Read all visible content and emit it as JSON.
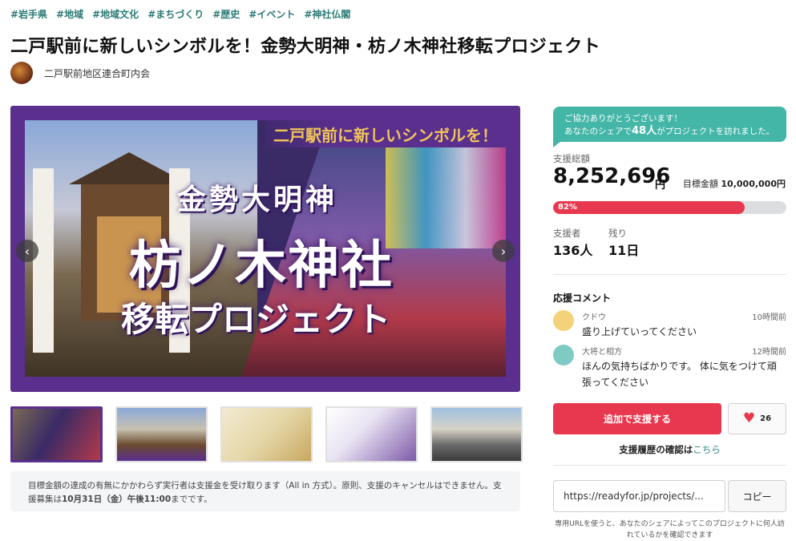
{
  "tags": [
    "#岩手県",
    "#地域",
    "#地域文化",
    "#まちづくり",
    "#歴史",
    "#イベント",
    "#神社仏閣"
  ],
  "title": "二戸駅前に新しいシンボルを！金勢大明神・枋ノ木神社移転プロジェクト",
  "owner": {
    "name": "二戸駅前地区連合町内会",
    "avatar_icon": "owner-avatar-icon"
  },
  "hero": {
    "banner_text": "二戸駅前に新しいシンボルを！",
    "line1": "金勢大明神",
    "line2": "枋ノ木神社",
    "line3": "移転プロジェクト",
    "prev_icon": "chevron-left-icon",
    "next_icon": "chevron-right-icon",
    "accent": "#5a2f8e"
  },
  "thumbnails_count": 5,
  "notice": {
    "text": "目標金額の達成の有無にかかわらず実行者は支援金を受け取ります（All in 方式）。原則、支援のキャンセルはできません。支援募集は",
    "deadline": "10月31日（金）午後11:00",
    "suffix": "までです。"
  },
  "share_bubble": {
    "line1": "ご協力ありがとうございます！",
    "line2_prefix": "あなたのシェアで",
    "count": "48人",
    "line2_suffix": "がプロジェクトを訪れました。",
    "color": "#43b6a7"
  },
  "funding": {
    "total_label": "支援総額",
    "total": "8,252,696",
    "unit": "円",
    "goal_label": "目標金額",
    "goal": "10,000,000円",
    "percent": 82,
    "percent_label": "82%",
    "supporters_label": "支援者",
    "supporters": "136人",
    "remaining_label": "残り",
    "remaining": "11日",
    "accent": "#e8384f"
  },
  "comments": {
    "heading": "応援コメント",
    "items": [
      {
        "name": "クドウ",
        "time": "10時間前",
        "text": "盛り上げていってください",
        "avatar_color": "#f3d27a"
      },
      {
        "name": "大将と相方",
        "time": "12時間前",
        "text": "ほんの気持ちばかりです。 体に気をつけて頑張ってください",
        "avatar_color": "#7fcbc4"
      }
    ]
  },
  "actions": {
    "support_label": "追加で支援する",
    "favorite_icon": "heart-icon",
    "favorite_count": "26",
    "history_prefix": "支援履歴の確認は",
    "history_link": "こちら"
  },
  "share": {
    "url": "https://readyfor.jp/projects/...",
    "copy_label": "コピー",
    "note": "専用URLを使うと、あなたのシェアによってこのプロジェクトに何人訪れているかを確認できます"
  }
}
